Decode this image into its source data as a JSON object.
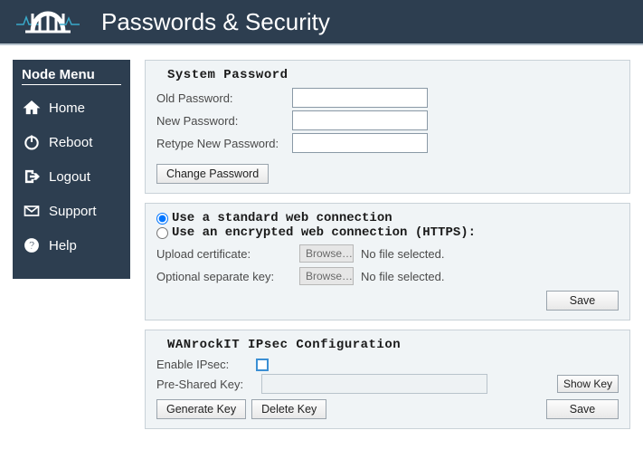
{
  "header": {
    "title": "Passwords & Security"
  },
  "sidebar": {
    "title": "Node Menu",
    "items": [
      {
        "label": "Home"
      },
      {
        "label": "Reboot"
      },
      {
        "label": "Logout"
      },
      {
        "label": "Support"
      },
      {
        "label": "Help"
      }
    ]
  },
  "password_panel": {
    "heading": "System Password",
    "old_label": "Old Password:",
    "new_label": "New Password:",
    "retype_label": "Retype New Password:",
    "old_value": "",
    "new_value": "",
    "retype_value": "",
    "change_button": "Change Password"
  },
  "connection_panel": {
    "radio_standard": "Use a standard web connection",
    "radio_encrypted": "Use an encrypted web connection (HTTPS):",
    "selected": "standard",
    "upload_cert_label": "Upload certificate:",
    "optional_key_label": "Optional separate key:",
    "browse_label": "Browse…",
    "no_file_text": "No file selected.",
    "save_label": "Save"
  },
  "ipsec_panel": {
    "heading": "WANrockIT IPsec Configuration",
    "enable_label": "Enable IPsec:",
    "enable_checked": false,
    "psk_label": "Pre-Shared Key:",
    "psk_value": "",
    "showkey_label": "Show Key",
    "generate_label": "Generate Key",
    "delete_label": "Delete Key",
    "save_label": "Save"
  }
}
